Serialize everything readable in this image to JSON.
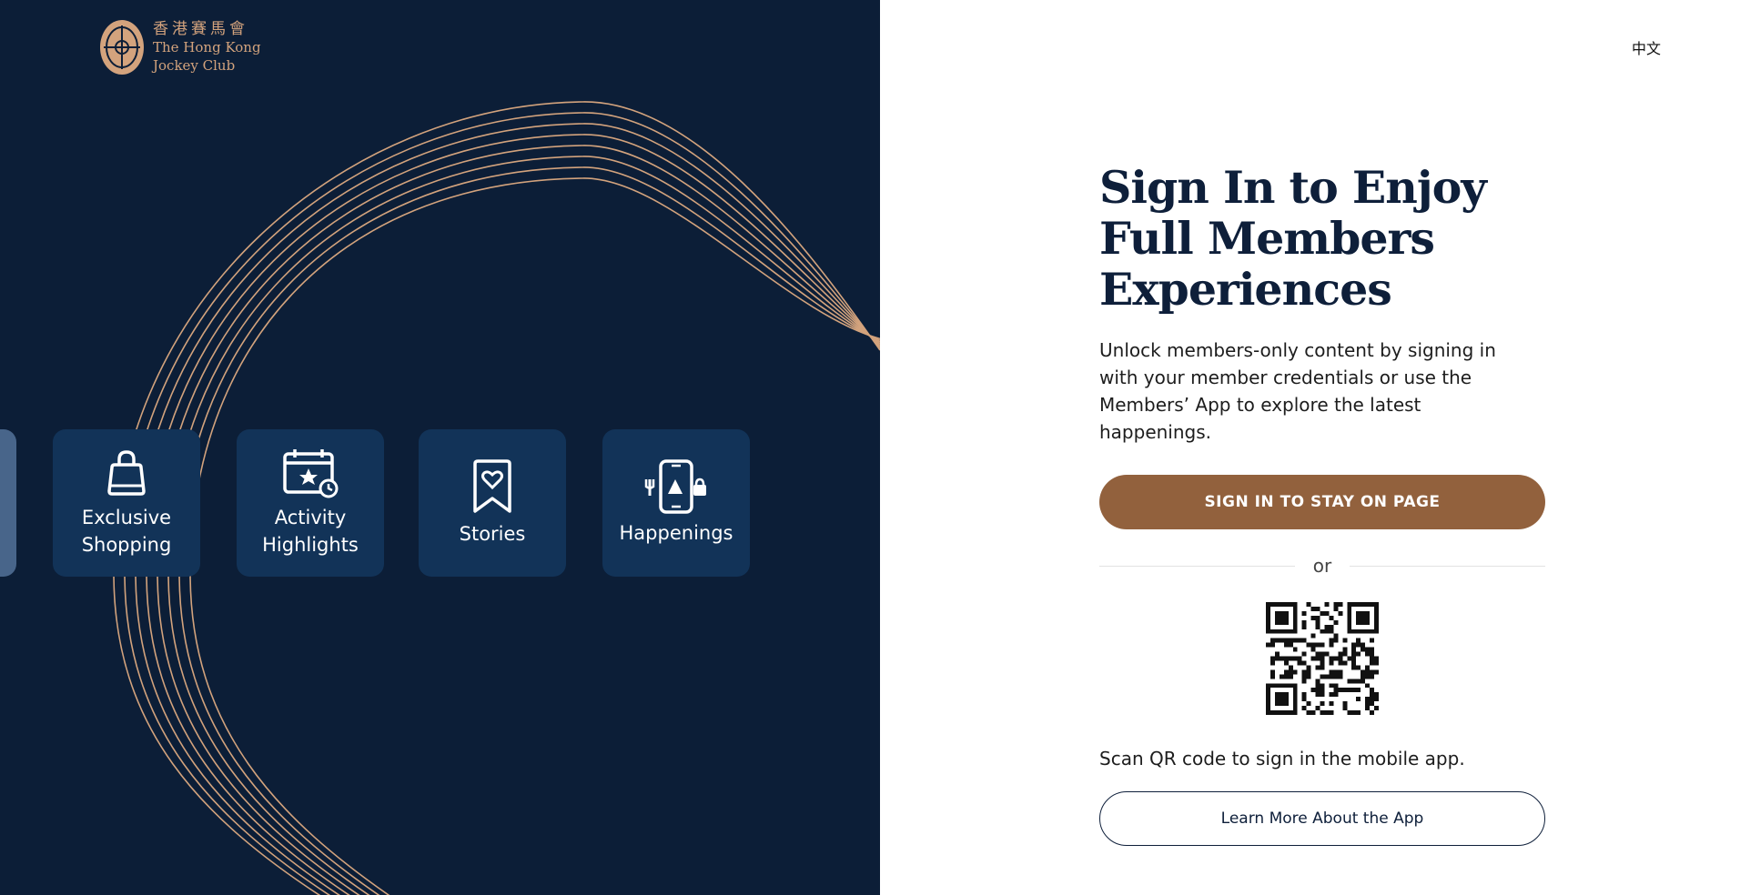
{
  "brand": {
    "name_zh": "香港賽馬會",
    "name_en_line1": "The Hong Kong",
    "name_en_line2": "Jockey Club"
  },
  "language_toggle": "中文",
  "feature_cards": [
    {
      "label": "Exclusive Shopping",
      "icon": "shopping-bag-icon"
    },
    {
      "label": "Activity Highlights",
      "icon": "calendar-star-icon"
    },
    {
      "label": "Stories",
      "icon": "bookmark-heart-icon"
    },
    {
      "label": "Happenings",
      "icon": "phone-happenings-icon"
    }
  ],
  "signin": {
    "title": "Sign In to Enjoy Full Members Experiences",
    "description": "Unlock members-only content by signing in with your member credentials or use the Members’ App to explore the latest happenings.",
    "signin_button": "SIGN IN TO STAY ON PAGE",
    "or_text": "or",
    "qr_caption": "Scan QR code to sign in the mobile app.",
    "learn_button": "Learn More About the App"
  },
  "colors": {
    "left_bg": "#0c1e37",
    "card_bg": "#123358",
    "accent_gold": "#d3a37d",
    "signin_button": "#92613d",
    "heading": "#0e1f3a"
  }
}
